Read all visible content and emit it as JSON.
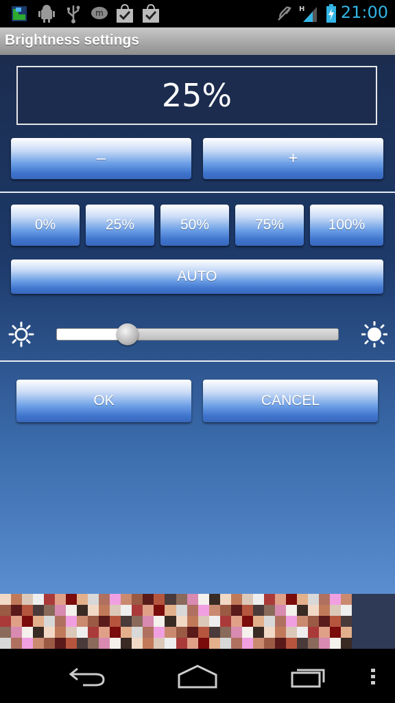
{
  "status_bar": {
    "time": "21:00",
    "icons": [
      "app-icon",
      "android-debug-icon",
      "usb-icon",
      "messenger-icon",
      "shopping-bag-check-icon",
      "shopping-bag-check-icon",
      "mute-icon",
      "signal-h-icon",
      "battery-charging-icon"
    ],
    "time_color": "#33b5e5"
  },
  "title_bar": {
    "title": "Brightness settings"
  },
  "brightness": {
    "value_text": "25%",
    "level": 0.25,
    "decrease_label": "–",
    "increase_label": "+"
  },
  "presets": [
    "0%",
    "25%",
    "50%",
    "75%",
    "100%"
  ],
  "auto_label": "AUTO",
  "slider": {
    "min_icon": "sun-dim-icon",
    "max_icon": "sun-bright-icon"
  },
  "dialog": {
    "ok_label": "OK",
    "cancel_label": "CANCEL"
  },
  "nav_bar": {
    "items": [
      "back-icon",
      "home-icon",
      "recent-apps-icon",
      "menu-icon"
    ]
  },
  "colors": {
    "accent": "#4a7fd6",
    "background_top": "#1b2c4e",
    "background_bottom": "#5a8ed0"
  }
}
